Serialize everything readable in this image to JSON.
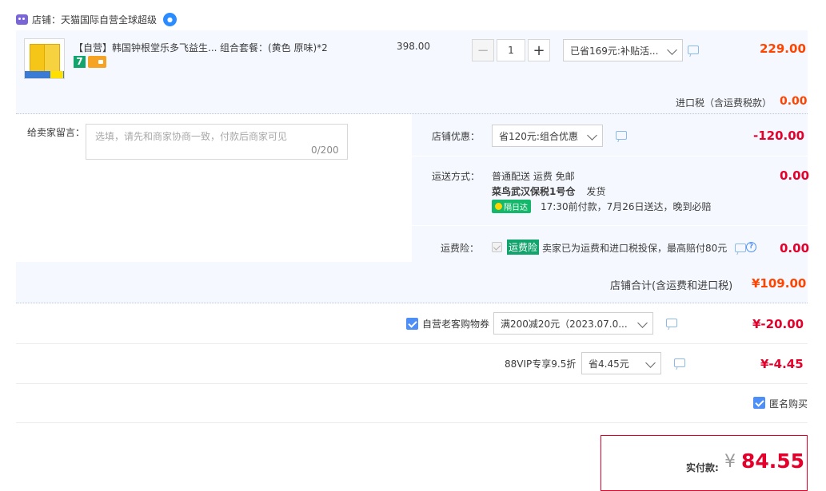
{
  "store": {
    "label": "店铺：",
    "name": "天猫国际自营全球超级",
    "badge_icon": "drop-badge-icon"
  },
  "item": {
    "title": "【自营】韩国钟根堂乐多飞益生...",
    "sku": "组合套餐：(黄色 原味)*2",
    "badge_number": "7",
    "unit_price": "398.00",
    "quantity": "1",
    "minus_label": "−",
    "plus_label": "+",
    "promo_select": "已省169元:补贴活...",
    "subtotal": "229.00"
  },
  "import_tax": {
    "label": "进口税（含运费税款）",
    "value": "0.00"
  },
  "note": {
    "label": "给卖家留言：",
    "placeholder": "选填，请先和商家协商一致，付款后商家可见",
    "counter": "0/200"
  },
  "shop_discount": {
    "label": "店铺优惠：",
    "select": "省120元:组合优惠",
    "value": "-120.00"
  },
  "shipping": {
    "label": "运送方式：",
    "line1": "普通配送 运费 免邮",
    "line2_bold": "菜鸟武汉保税1号仓",
    "line2_rest": "发货",
    "pill": "隔日达",
    "line3": "17:30前付款，7月26日送达，晚到必赔",
    "value": "0.00"
  },
  "insurance": {
    "label": "运费险：",
    "tag": "运费险",
    "text": "卖家已为运费和进口税投保，最高赔付80元",
    "value": "0.00"
  },
  "store_total": {
    "label": "店铺合计(含运费和进口税)",
    "value": "¥109.00"
  },
  "coupon": {
    "label": "自营老客购物券",
    "select": "满200减20元（2023.07.0...",
    "value": "¥-20.00"
  },
  "vip": {
    "label": "88VIP专享9.5折",
    "select": "省4.45元",
    "value": "¥-4.45"
  },
  "anonymous": {
    "label": "匿名购买"
  },
  "payment": {
    "label": "实付款:",
    "currency": "¥",
    "amount": "84.55"
  },
  "colors": {
    "accent_blue": "#4d8ef7",
    "price_orange": "#ff4400",
    "price_red": "#e4002b",
    "panel_bg": "#f5f9ff"
  }
}
